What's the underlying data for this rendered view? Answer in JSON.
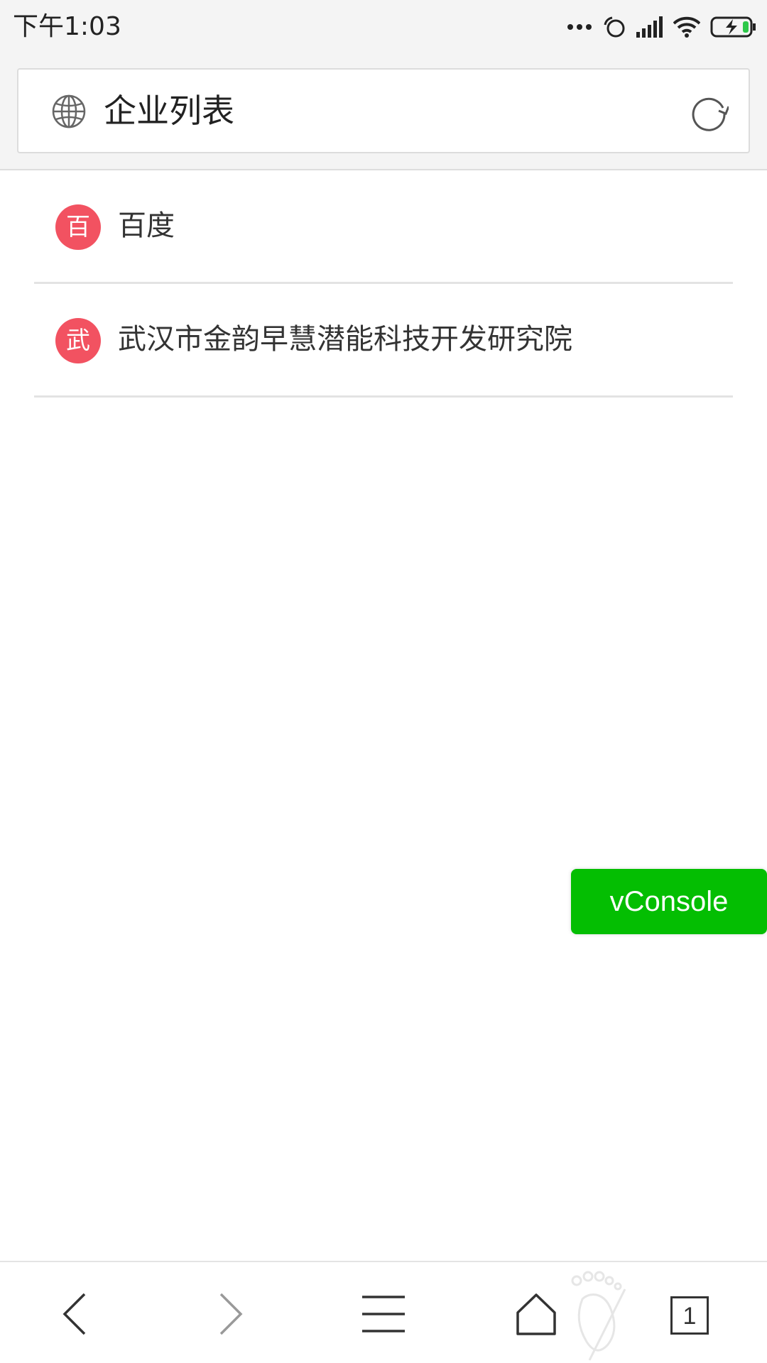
{
  "status_bar": {
    "time": "下午1:03",
    "icons": [
      "more-dots-icon",
      "alarm-icon",
      "signal-icon",
      "wifi-icon",
      "battery-charging-icon"
    ]
  },
  "header": {
    "title": "企业列表",
    "left_icon": "globe-icon",
    "right_icon": "refresh-icon"
  },
  "list": {
    "items": [
      {
        "badge": "百",
        "label": "百度"
      },
      {
        "badge": "武",
        "label": "武汉市金韵早慧潜能科技开发研究院"
      }
    ]
  },
  "vconsole": {
    "label": "vConsole"
  },
  "bottom_bar": {
    "buttons": [
      "back-icon",
      "forward-icon",
      "menu-icon",
      "home-icon",
      "tabs-icon"
    ],
    "tab_count": "1"
  },
  "colors": {
    "badge": "#f25261",
    "vconsole": "#04be02",
    "status_bg": "#f4f4f4"
  }
}
